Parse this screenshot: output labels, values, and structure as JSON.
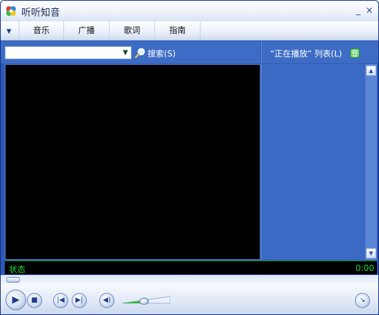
{
  "window": {
    "title": "听听知音"
  },
  "title_buttons": {
    "minimize": "_",
    "close": "×"
  },
  "menu": {
    "dropdown_glyph": "▼",
    "tabs": [
      {
        "label": "音乐"
      },
      {
        "label": "广播"
      },
      {
        "label": "歌词"
      },
      {
        "label": "指南"
      }
    ]
  },
  "search": {
    "value": "",
    "placeholder": "",
    "dropdown_glyph": "▼",
    "button_label": "搜索(S)"
  },
  "playlist": {
    "title": "“正在播放” 列表(L)",
    "scroll_up_glyph": "▲",
    "scroll_down_glyph": "▼"
  },
  "status": {
    "text": "状态",
    "time": "0:00"
  },
  "playback": {
    "seek_position": 0,
    "volume_level": 0.45
  },
  "controls": {
    "play_glyph": "▶",
    "stop_glyph": "■",
    "prev_glyph": "|◀",
    "next_glyph": "▶|",
    "mute_glyph": "◀)",
    "mini_glyph": "↘"
  },
  "colors": {
    "window_blue": "#2e57b6",
    "status_green": "#23d442",
    "video_black": "#000000"
  },
  "icons": {
    "app": "app-logo-icon",
    "search": "magnifier-icon",
    "playlist_menu": "list-menu-icon"
  }
}
